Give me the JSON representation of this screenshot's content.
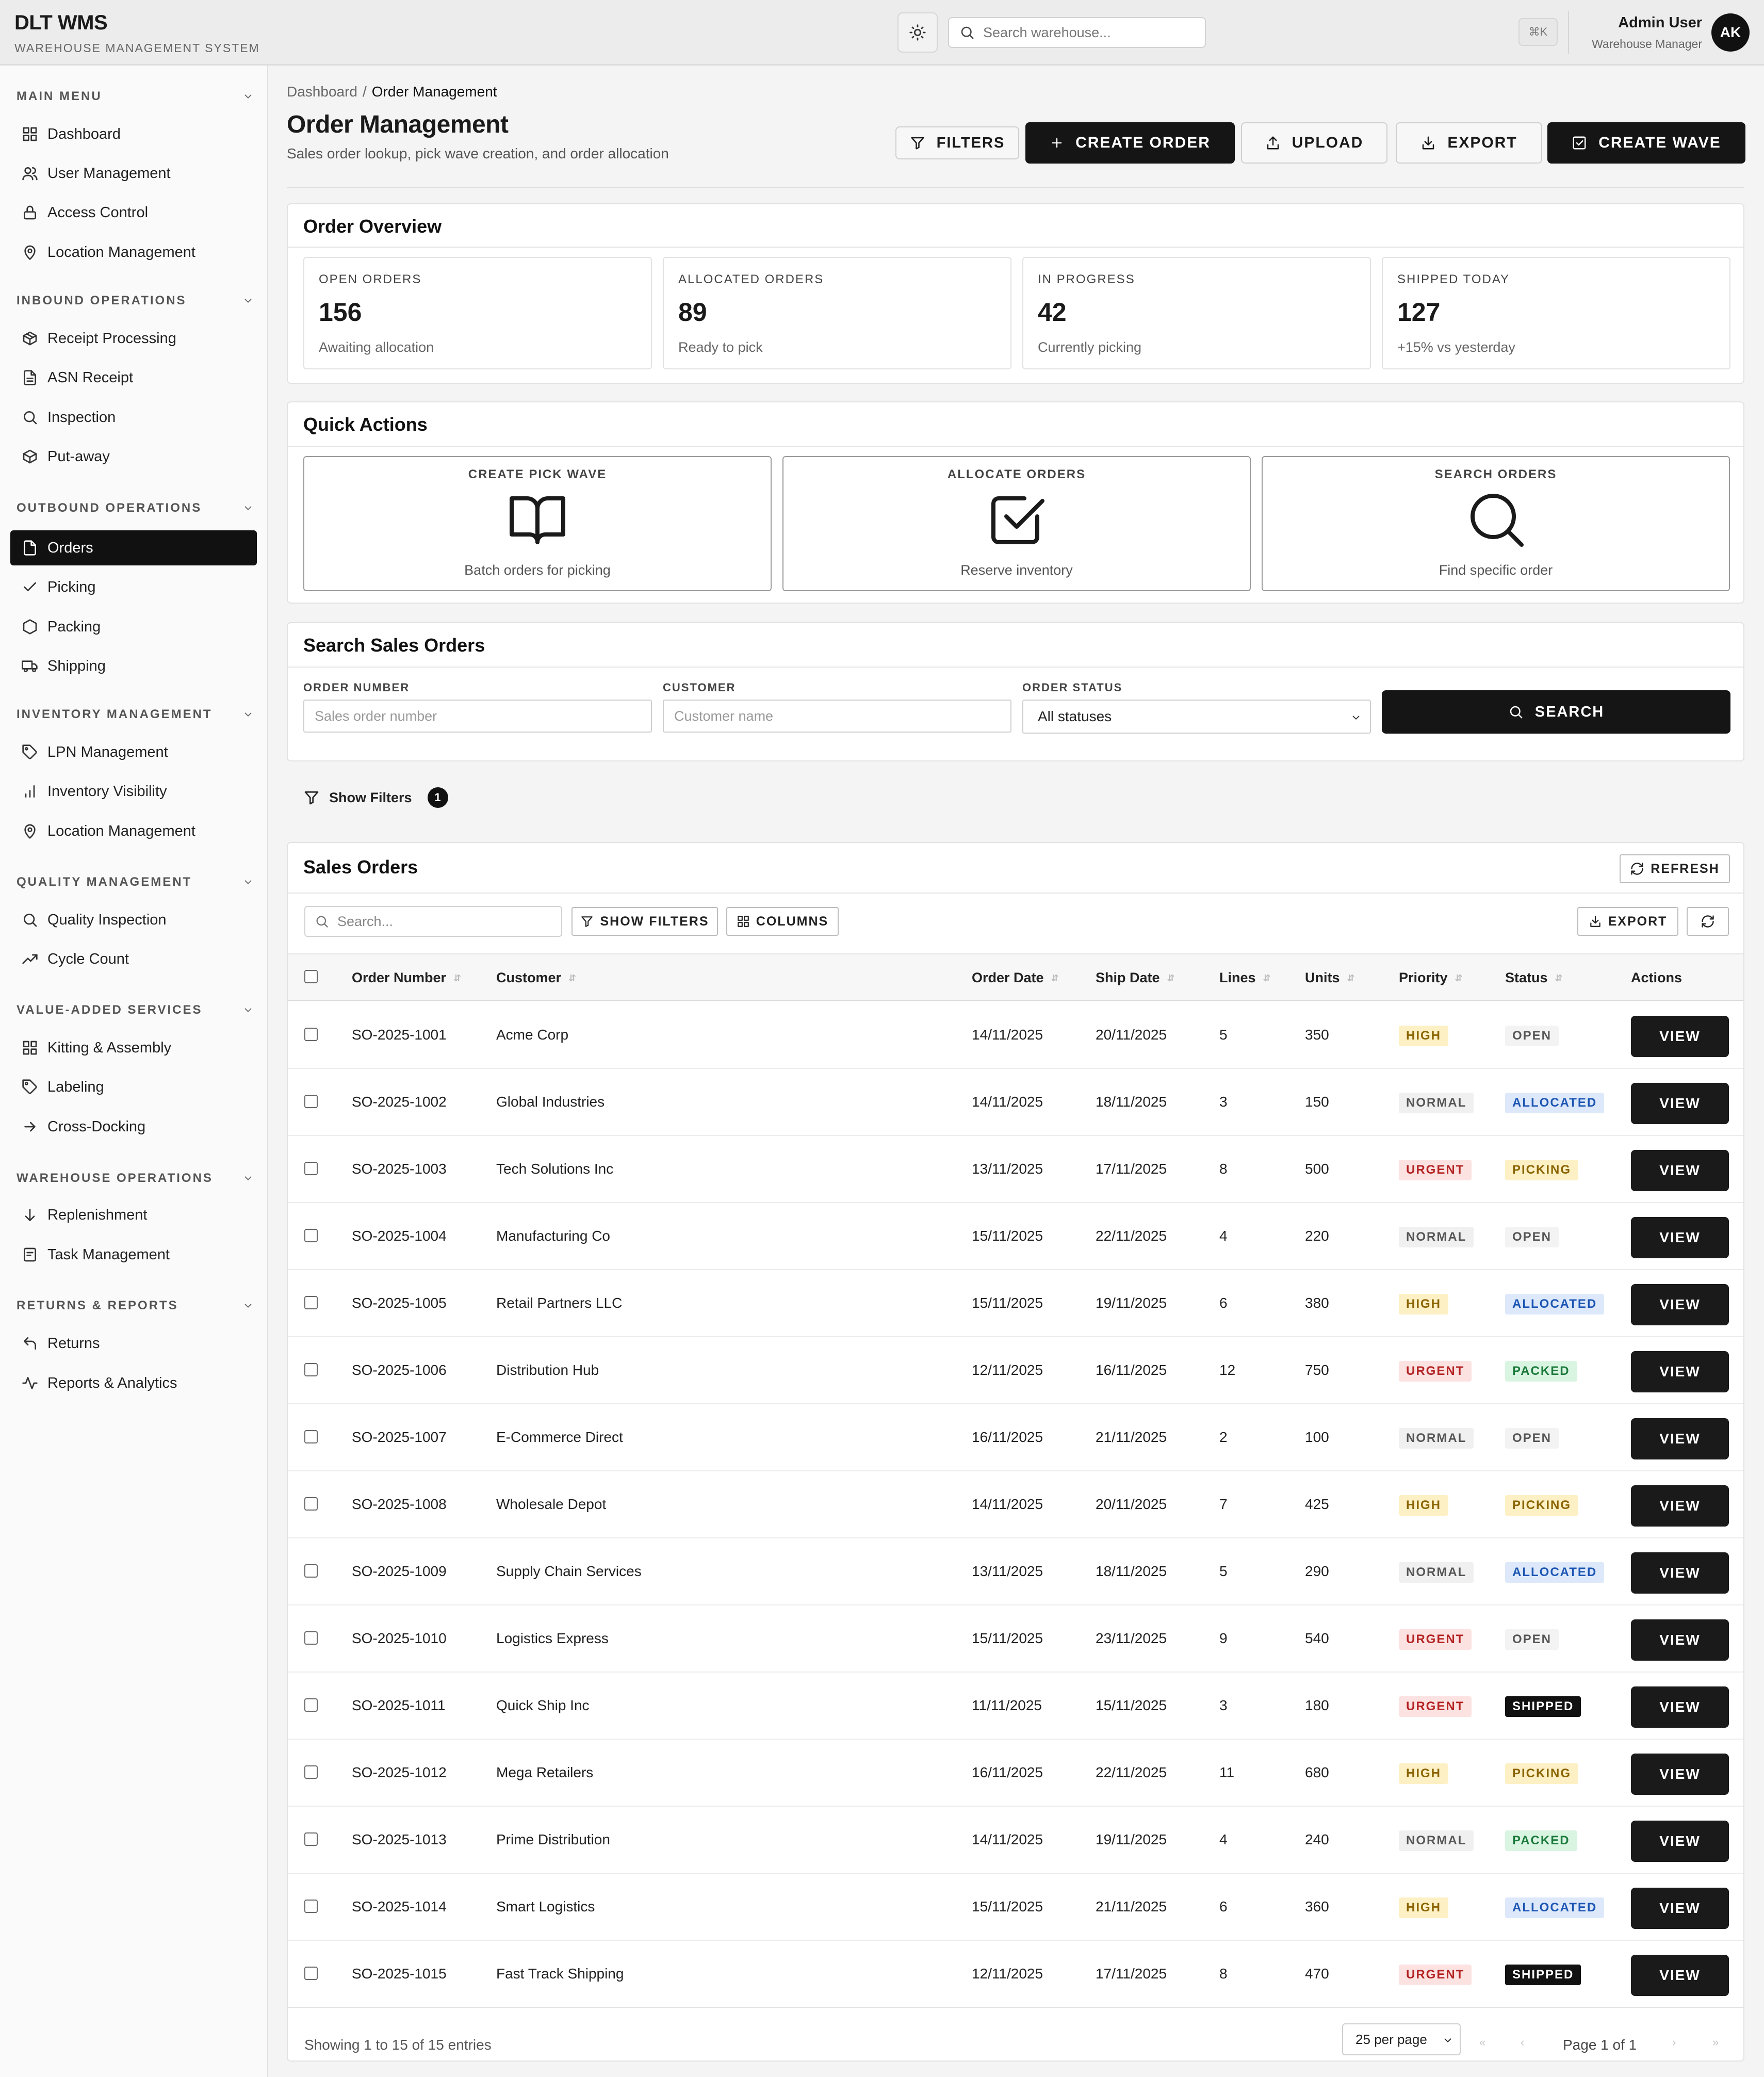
{
  "header": {
    "brand_title": "DLT WMS",
    "brand_subtitle": "WAREHOUSE MANAGEMENT SYSTEM",
    "search_placeholder": "Search warehouse...",
    "shortcut": "⌘K",
    "user_name": "Admin User",
    "user_role": "Warehouse Manager",
    "avatar_initials": "AK"
  },
  "sidebar": {
    "sections": [
      {
        "title": "MAIN MENU",
        "items": [
          "Dashboard",
          "User Management",
          "Access Control",
          "Location Management"
        ]
      },
      {
        "title": "INBOUND OPERATIONS",
        "items": [
          "Receipt Processing",
          "ASN Receipt",
          "Inspection",
          "Put-away"
        ]
      },
      {
        "title": "OUTBOUND OPERATIONS",
        "items": [
          "Orders",
          "Picking",
          "Packing",
          "Shipping"
        ]
      },
      {
        "title": "INVENTORY MANAGEMENT",
        "items": [
          "LPN Management",
          "Inventory Visibility",
          "Location Management"
        ]
      },
      {
        "title": "QUALITY MANAGEMENT",
        "items": [
          "Quality Inspection",
          "Cycle Count"
        ]
      },
      {
        "title": "VALUE-ADDED SERVICES",
        "items": [
          "Kitting & Assembly",
          "Labeling",
          "Cross-Docking"
        ]
      },
      {
        "title": "WAREHOUSE OPERATIONS",
        "items": [
          "Replenishment",
          "Task Management"
        ]
      },
      {
        "title": "RETURNS & REPORTS",
        "items": [
          "Returns",
          "Reports & Analytics"
        ]
      }
    ],
    "active_item": "Orders"
  },
  "breadcrumb": {
    "parent": "Dashboard",
    "separator": "/",
    "current": "Order Management"
  },
  "page": {
    "title": "Order Management",
    "subtitle": "Sales order lookup, pick wave creation, and order allocation"
  },
  "toolbar": {
    "filters": "FILTERS",
    "create_order": "CREATE ORDER",
    "upload": "UPLOAD",
    "export": "EXPORT",
    "create_wave": "CREATE WAVE"
  },
  "overview": {
    "title": "Order Overview",
    "stats": [
      {
        "label": "OPEN ORDERS",
        "value": "156",
        "note": "Awaiting allocation"
      },
      {
        "label": "ALLOCATED ORDERS",
        "value": "89",
        "note": "Ready to pick"
      },
      {
        "label": "IN PROGRESS",
        "value": "42",
        "note": "Currently picking"
      },
      {
        "label": "SHIPPED TODAY",
        "value": "127",
        "note": "+15% vs yesterday"
      }
    ]
  },
  "quick_actions": {
    "title": "Quick Actions",
    "items": [
      {
        "label": "CREATE PICK WAVE",
        "note": "Batch orders for picking",
        "icon": "book-open-icon"
      },
      {
        "label": "ALLOCATE ORDERS",
        "note": "Reserve inventory",
        "icon": "check-square-icon"
      },
      {
        "label": "SEARCH ORDERS",
        "note": "Find specific order",
        "icon": "search-icon"
      }
    ]
  },
  "search_form": {
    "title": "Search Sales Orders",
    "order_number_label": "ORDER NUMBER",
    "order_number_placeholder": "Sales order number",
    "customer_label": "CUSTOMER",
    "customer_placeholder": "Customer name",
    "status_label": "ORDER STATUS",
    "status_value": "All statuses",
    "search_button": "SEARCH"
  },
  "show_filters": {
    "label": "Show Filters",
    "count": "1"
  },
  "orders_table": {
    "title": "Sales Orders",
    "refresh_label": "REFRESH",
    "search_placeholder": "Search...",
    "show_filters_label": "SHOW FILTERS",
    "columns_label": "COLUMNS",
    "export_label": "EXPORT",
    "columns": [
      "Order Number",
      "Customer",
      "Order Date",
      "Ship Date",
      "Lines",
      "Units",
      "Priority",
      "Status",
      "Actions"
    ],
    "view_label": "VIEW",
    "rows": [
      {
        "order": "SO-2025-1001",
        "customer": "Acme Corp",
        "order_date": "14/11/2025",
        "ship_date": "20/11/2025",
        "lines": "5",
        "units": "350",
        "priority": "HIGH",
        "status": "OPEN"
      },
      {
        "order": "SO-2025-1002",
        "customer": "Global Industries",
        "order_date": "14/11/2025",
        "ship_date": "18/11/2025",
        "lines": "3",
        "units": "150",
        "priority": "NORMAL",
        "status": "ALLOCATED"
      },
      {
        "order": "SO-2025-1003",
        "customer": "Tech Solutions Inc",
        "order_date": "13/11/2025",
        "ship_date": "17/11/2025",
        "lines": "8",
        "units": "500",
        "priority": "URGENT",
        "status": "PICKING"
      },
      {
        "order": "SO-2025-1004",
        "customer": "Manufacturing Co",
        "order_date": "15/11/2025",
        "ship_date": "22/11/2025",
        "lines": "4",
        "units": "220",
        "priority": "NORMAL",
        "status": "OPEN"
      },
      {
        "order": "SO-2025-1005",
        "customer": "Retail Partners LLC",
        "order_date": "15/11/2025",
        "ship_date": "19/11/2025",
        "lines": "6",
        "units": "380",
        "priority": "HIGH",
        "status": "ALLOCATED"
      },
      {
        "order": "SO-2025-1006",
        "customer": "Distribution Hub",
        "order_date": "12/11/2025",
        "ship_date": "16/11/2025",
        "lines": "12",
        "units": "750",
        "priority": "URGENT",
        "status": "PACKED"
      },
      {
        "order": "SO-2025-1007",
        "customer": "E-Commerce Direct",
        "order_date": "16/11/2025",
        "ship_date": "21/11/2025",
        "lines": "2",
        "units": "100",
        "priority": "NORMAL",
        "status": "OPEN"
      },
      {
        "order": "SO-2025-1008",
        "customer": "Wholesale Depot",
        "order_date": "14/11/2025",
        "ship_date": "20/11/2025",
        "lines": "7",
        "units": "425",
        "priority": "HIGH",
        "status": "PICKING"
      },
      {
        "order": "SO-2025-1009",
        "customer": "Supply Chain Services",
        "order_date": "13/11/2025",
        "ship_date": "18/11/2025",
        "lines": "5",
        "units": "290",
        "priority": "NORMAL",
        "status": "ALLOCATED"
      },
      {
        "order": "SO-2025-1010",
        "customer": "Logistics Express",
        "order_date": "15/11/2025",
        "ship_date": "23/11/2025",
        "lines": "9",
        "units": "540",
        "priority": "URGENT",
        "status": "OPEN"
      },
      {
        "order": "SO-2025-1011",
        "customer": "Quick Ship Inc",
        "order_date": "11/11/2025",
        "ship_date": "15/11/2025",
        "lines": "3",
        "units": "180",
        "priority": "URGENT",
        "status": "SHIPPED"
      },
      {
        "order": "SO-2025-1012",
        "customer": "Mega Retailers",
        "order_date": "16/11/2025",
        "ship_date": "22/11/2025",
        "lines": "11",
        "units": "680",
        "priority": "HIGH",
        "status": "PICKING"
      },
      {
        "order": "SO-2025-1013",
        "customer": "Prime Distribution",
        "order_date": "14/11/2025",
        "ship_date": "19/11/2025",
        "lines": "4",
        "units": "240",
        "priority": "NORMAL",
        "status": "PACKED"
      },
      {
        "order": "SO-2025-1014",
        "customer": "Smart Logistics",
        "order_date": "15/11/2025",
        "ship_date": "21/11/2025",
        "lines": "6",
        "units": "360",
        "priority": "HIGH",
        "status": "ALLOCATED"
      },
      {
        "order": "SO-2025-1015",
        "customer": "Fast Track Shipping",
        "order_date": "12/11/2025",
        "ship_date": "17/11/2025",
        "lines": "8",
        "units": "470",
        "priority": "URGENT",
        "status": "SHIPPED"
      }
    ],
    "footer_text": "Showing 1 to 15 of 15 entries",
    "per_page": "25 per page",
    "page_text": "Page 1 of 1"
  },
  "colors": {
    "priority": {
      "HIGH": {
        "bg": "#fdf0c4",
        "fg": "#8a6400"
      },
      "NORMAL": {
        "bg": "#f0f0f0",
        "fg": "#555555"
      },
      "URGENT": {
        "bg": "#fde2e2",
        "fg": "#b42323"
      }
    },
    "status": {
      "OPEN": {
        "bg": "#f3f3f3",
        "fg": "#555555"
      },
      "ALLOCATED": {
        "bg": "#dde9fb",
        "fg": "#1d56b3"
      },
      "PICKING": {
        "bg": "#fdf0c4",
        "fg": "#8a6400"
      },
      "PACKED": {
        "bg": "#d9f5e2",
        "fg": "#1c7a3c"
      },
      "SHIPPED": {
        "bg": "#111111",
        "fg": "#ffffff"
      }
    }
  }
}
